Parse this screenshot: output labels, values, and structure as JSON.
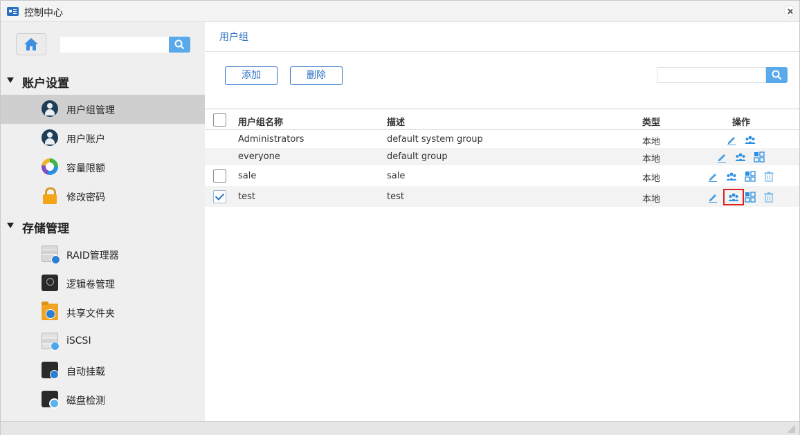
{
  "window": {
    "title": "控制中心"
  },
  "sidebar": {
    "search": {
      "placeholder": "",
      "value": ""
    },
    "sections": [
      {
        "label": "账户设置",
        "items": [
          {
            "label": "用户组管理",
            "icon": "user-group-icon",
            "active": true
          },
          {
            "label": "用户账户",
            "icon": "user-account-icon",
            "active": false
          },
          {
            "label": "容量限额",
            "icon": "quota-pie-icon",
            "active": false
          },
          {
            "label": "修改密码",
            "icon": "lock-icon",
            "active": false
          }
        ]
      },
      {
        "label": "存储管理",
        "items": [
          {
            "label": "RAID管理器",
            "icon": "raid-icon",
            "active": false
          },
          {
            "label": "逻辑卷管理",
            "icon": "logical-volume-icon",
            "active": false
          },
          {
            "label": "共享文件夹",
            "icon": "shared-folder-icon",
            "active": false
          },
          {
            "label": "iSCSI",
            "icon": "iscsi-icon",
            "active": false
          },
          {
            "label": "自动挂载",
            "icon": "auto-mount-icon",
            "active": false
          },
          {
            "label": "磁盘检测",
            "icon": "disk-check-icon",
            "active": false
          }
        ]
      }
    ]
  },
  "main": {
    "breadcrumb": "用户组",
    "toolbar": {
      "add_label": "添加",
      "delete_label": "删除"
    },
    "search": {
      "placeholder": "",
      "value": ""
    },
    "table": {
      "columns": {
        "name": "用户组名称",
        "description": "描述",
        "type": "类型",
        "actions": "操作"
      },
      "rows": [
        {
          "name": "Administrators",
          "description": "default system group",
          "type": "本地",
          "checkbox": "none",
          "actions": [
            "edit-icon",
            "group-members-icon"
          ]
        },
        {
          "name": "everyone",
          "description": "default group",
          "type": "本地",
          "checkbox": "none",
          "actions": [
            "edit-icon",
            "group-members-icon",
            "permissions-grid-icon"
          ]
        },
        {
          "name": "sale",
          "description": "sale",
          "type": "本地",
          "checkbox": "unchecked",
          "actions": [
            "edit-icon",
            "group-members-icon",
            "permissions-grid-icon",
            "trash-icon"
          ]
        },
        {
          "name": "test",
          "description": "test",
          "type": "本地",
          "checkbox": "checked",
          "actions": [
            "edit-icon",
            "group-members-icon",
            "permissions-grid-icon",
            "trash-icon"
          ],
          "highlighted_action": "group-members-icon"
        }
      ]
    }
  },
  "colors": {
    "accent": "#2b6fc3",
    "search_button": "#5aa9ea",
    "highlight_outline": "#e02020",
    "active_nav": "#cfcfcf"
  }
}
